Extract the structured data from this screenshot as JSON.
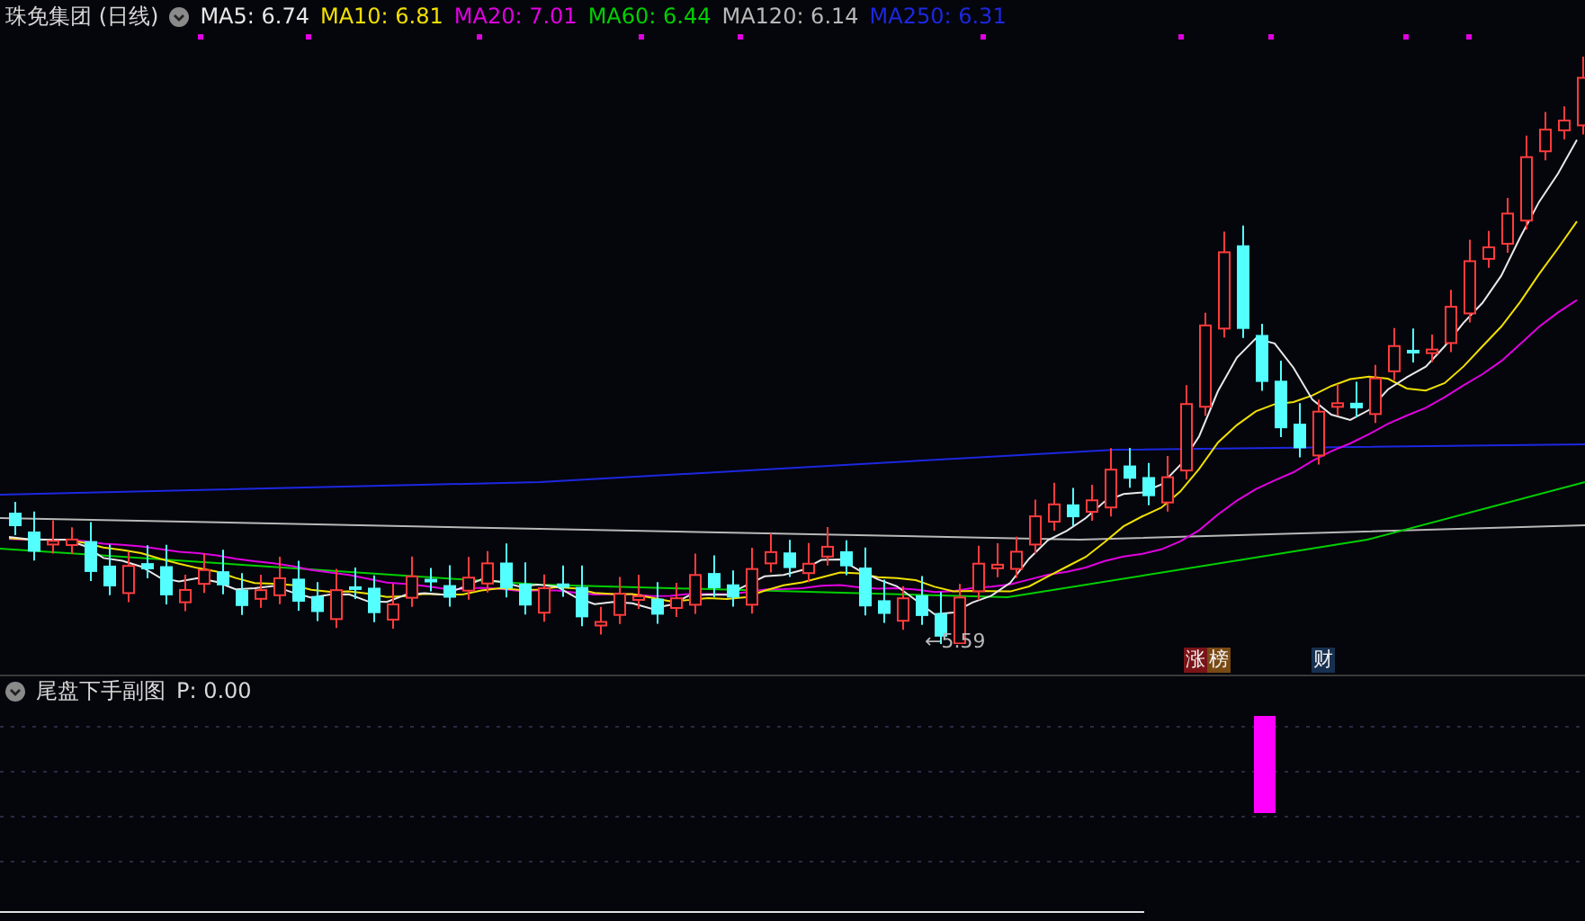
{
  "main_panel": {
    "title": "珠免集团 (日线)",
    "indicators": [
      {
        "label": "MA5: 6.74",
        "color": "#e8e8e8"
      },
      {
        "label": "MA10: 6.81",
        "color": "#f0e000"
      },
      {
        "label": "MA20: 7.01",
        "color": "#e000e0"
      },
      {
        "label": "MA60: 6.44",
        "color": "#00d000"
      },
      {
        "label": "MA120: 6.14",
        "color": "#b8b8b8"
      },
      {
        "label": "MA250: 6.31",
        "color": "#1c28e0"
      }
    ],
    "low_marker": "←5.59",
    "event_badges": [
      {
        "label": "涨",
        "color": "#7a1418"
      },
      {
        "label": "榜",
        "color": "#7a4a14"
      },
      {
        "label": "财",
        "color": "#183050"
      }
    ]
  },
  "sub_panel": {
    "title": "尾盘下手副图",
    "reading": "P: 0.00"
  }
}
